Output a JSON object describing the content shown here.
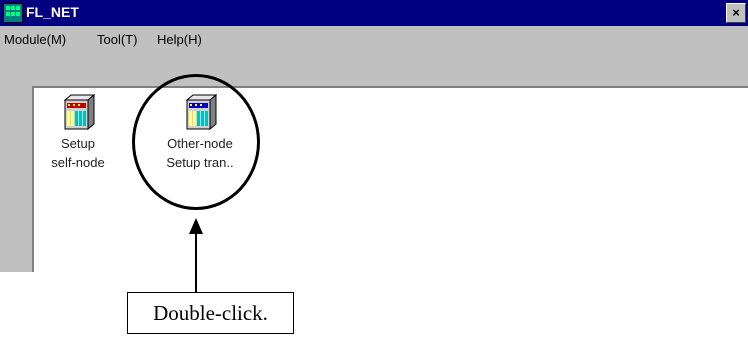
{
  "window": {
    "title": "FL_NET",
    "close_symbol": "×"
  },
  "menubar": {
    "items": [
      {
        "label": "Module(M)"
      },
      {
        "label": "Tool(T)"
      },
      {
        "label": "Help(H)"
      }
    ]
  },
  "icons": [
    {
      "label": "Setup\nself-node",
      "icon": "rack-module-icon"
    },
    {
      "label": "Other-node\nSetup tran..",
      "icon": "rack-module-icon"
    }
  ],
  "annotation": {
    "callout_text": "Double-click."
  }
}
